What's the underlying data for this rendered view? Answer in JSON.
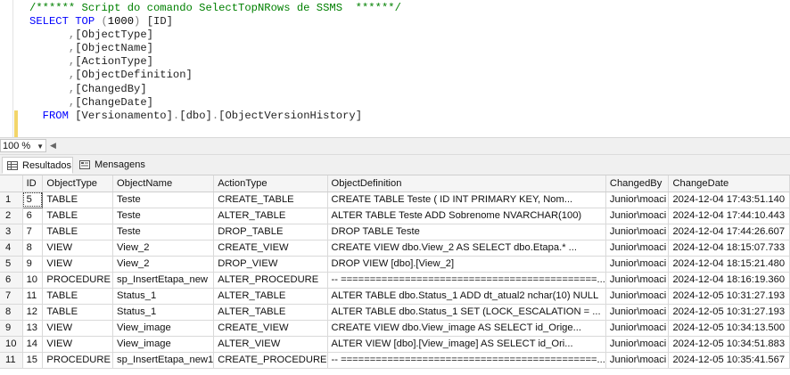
{
  "editor": {
    "lines": [
      {
        "parts": [
          {
            "c": "cm",
            "t": "/****** Script do comando SelectTopNRows de SSMS  ******/"
          }
        ]
      },
      {
        "parts": [
          {
            "c": "kw",
            "t": "SELECT TOP "
          },
          {
            "c": "gr",
            "t": "("
          },
          {
            "c": "num",
            "t": "1000"
          },
          {
            "c": "gr",
            "t": ")"
          },
          {
            "c": "",
            "t": " [ID]"
          }
        ]
      },
      {
        "parts": [
          {
            "c": "gr",
            "t": "      ,"
          },
          {
            "c": "",
            "t": "[ObjectType]"
          }
        ]
      },
      {
        "parts": [
          {
            "c": "gr",
            "t": "      ,"
          },
          {
            "c": "",
            "t": "[ObjectName]"
          }
        ]
      },
      {
        "parts": [
          {
            "c": "gr",
            "t": "      ,"
          },
          {
            "c": "",
            "t": "[ActionType]"
          }
        ]
      },
      {
        "parts": [
          {
            "c": "gr",
            "t": "      ,"
          },
          {
            "c": "",
            "t": "[ObjectDefinition]"
          }
        ]
      },
      {
        "parts": [
          {
            "c": "gr",
            "t": "      ,"
          },
          {
            "c": "",
            "t": "[ChangedBy]"
          }
        ]
      },
      {
        "parts": [
          {
            "c": "gr",
            "t": "      ,"
          },
          {
            "c": "",
            "t": "[ChangeDate]"
          }
        ]
      },
      {
        "parts": [
          {
            "c": "kw",
            "t": "  FROM "
          },
          {
            "c": "",
            "t": "[Versionamento]"
          },
          {
            "c": "gr",
            "t": "."
          },
          {
            "c": "",
            "t": "[dbo]"
          },
          {
            "c": "gr",
            "t": "."
          },
          {
            "c": "",
            "t": "[ObjectVersionHistory]"
          }
        ]
      }
    ]
  },
  "zoom": {
    "value": "100 %"
  },
  "tabs": {
    "results": "Resultados",
    "messages": "Mensagens"
  },
  "grid": {
    "columns": [
      "ID",
      "ObjectType",
      "ObjectName",
      "ActionType",
      "ObjectDefinition",
      "ChangedBy",
      "ChangeDate"
    ],
    "rows": [
      [
        "1",
        "5",
        "TABLE",
        "Teste",
        "CREATE_TABLE",
        "CREATE TABLE Teste (      ID INT PRIMARY KEY,     Nom...",
        "Junior\\moaci",
        "2024-12-04 17:43:51.140"
      ],
      [
        "2",
        "6",
        "TABLE",
        "Teste",
        "ALTER_TABLE",
        "ALTER TABLE Teste  ADD Sobrenome NVARCHAR(100)",
        "Junior\\moaci",
        "2024-12-04 17:44:10.443"
      ],
      [
        "3",
        "7",
        "TABLE",
        "Teste",
        "DROP_TABLE",
        "DROP TABLE Teste",
        "Junior\\moaci",
        "2024-12-04 17:44:26.607"
      ],
      [
        "4",
        "8",
        "VIEW",
        "View_2",
        "CREATE_VIEW",
        "CREATE VIEW dbo.View_2  AS  SELECT       dbo.Etapa.*  ...",
        "Junior\\moaci",
        "2024-12-04 18:15:07.733"
      ],
      [
        "5",
        "9",
        "VIEW",
        "View_2",
        "DROP_VIEW",
        "DROP VIEW [dbo].[View_2]",
        "Junior\\moaci",
        "2024-12-04 18:15:21.480"
      ],
      [
        "6",
        "10",
        "PROCEDURE",
        "sp_InsertEtapa_new",
        "ALTER_PROCEDURE",
        "  -- ============================================...",
        "Junior\\moaci",
        "2024-12-04 18:16:19.360"
      ],
      [
        "7",
        "11",
        "TABLE",
        "Status_1",
        "ALTER_TABLE",
        "ALTER TABLE dbo.Status_1 ADD   dt_atual2 nchar(10) NULL",
        "Junior\\moaci",
        "2024-12-05 10:31:27.193"
      ],
      [
        "8",
        "12",
        "TABLE",
        "Status_1",
        "ALTER_TABLE",
        "ALTER TABLE dbo.Status_1 SET (LOCK_ESCALATION = ...",
        "Junior\\moaci",
        "2024-12-05 10:31:27.193"
      ],
      [
        "9",
        "13",
        "VIEW",
        "View_image",
        "CREATE_VIEW",
        "CREATE VIEW dbo.View_image  AS  SELECT       id_Orige...",
        "Junior\\moaci",
        "2024-12-05 10:34:13.500"
      ],
      [
        "10",
        "14",
        "VIEW",
        "View_image",
        "ALTER_VIEW",
        "  ALTER VIEW [dbo].[View_image]  AS  SELECT       id_Ori...",
        "Junior\\moaci",
        "2024-12-05 10:34:51.883"
      ],
      [
        "11",
        "15",
        "PROCEDURE",
        "sp_InsertEtapa_new1",
        "CREATE_PROCEDURE",
        "     -- ============================================...",
        "Junior\\moaci",
        "2024-12-05 10:35:41.567"
      ]
    ]
  },
  "colors": {
    "keyword": "#0000ff",
    "comment": "#008000",
    "gutter_change": "#f2d56a"
  }
}
